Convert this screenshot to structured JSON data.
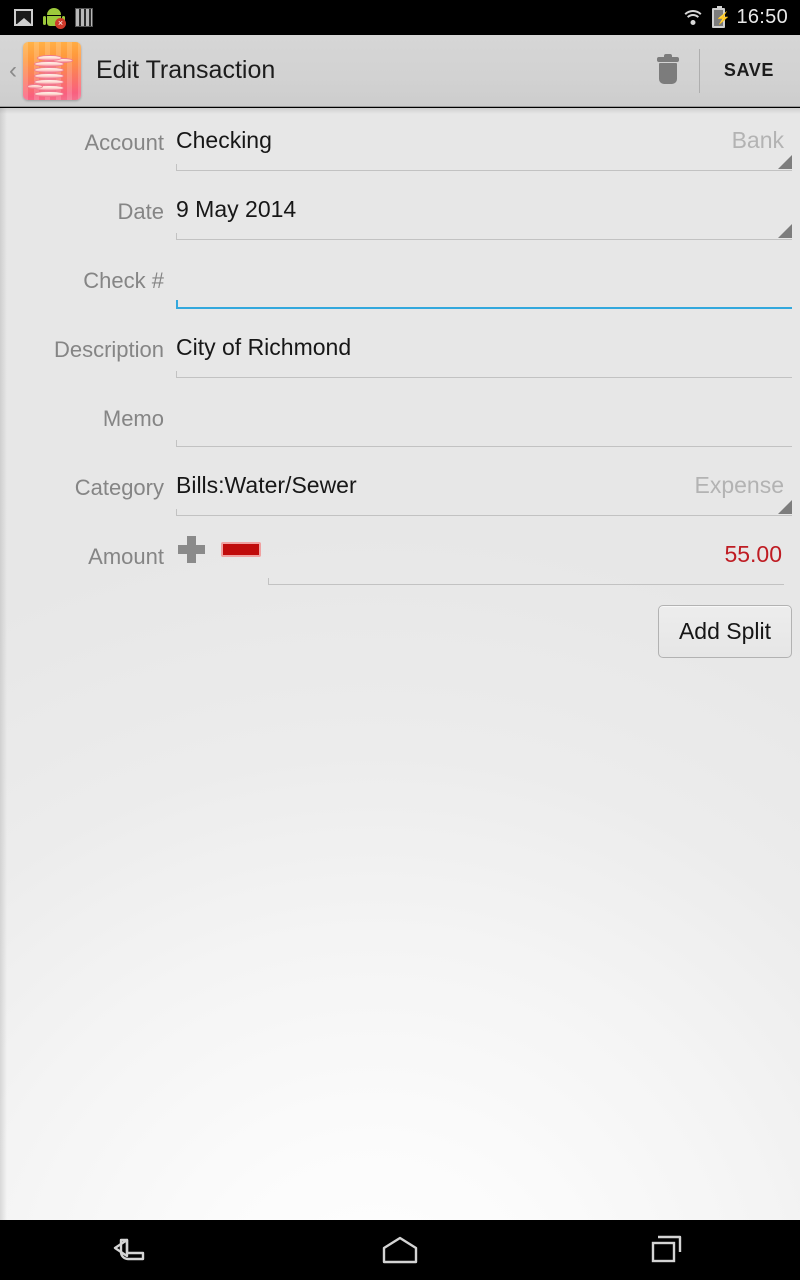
{
  "statusbar": {
    "time": "16:50",
    "icons": [
      {
        "name": "photo-icon"
      },
      {
        "name": "android-error-icon",
        "badge": "×"
      },
      {
        "name": "barcode-icon"
      },
      {
        "name": "wifi-icon"
      },
      {
        "name": "battery-charging-icon",
        "bolt": "⚡"
      }
    ]
  },
  "actionbar": {
    "back_glyph": "‹",
    "app_icon_name": "coin-stack-app-icon",
    "title": "Edit Transaction",
    "delete_icon_name": "trash-icon",
    "save_label": "SAVE"
  },
  "form": {
    "rows": [
      {
        "label": "Account",
        "value": "Checking",
        "hint": "Bank",
        "type": "spinner",
        "focused": false,
        "name": "account"
      },
      {
        "label": "Date",
        "value": "9 May 2014",
        "hint": "",
        "type": "spinner",
        "focused": false,
        "name": "date"
      },
      {
        "label": "Check #",
        "value": "",
        "hint": "",
        "type": "text",
        "focused": true,
        "name": "check-number"
      },
      {
        "label": "Description",
        "value": "City of Richmond",
        "hint": "",
        "type": "text",
        "focused": false,
        "name": "description"
      },
      {
        "label": "Memo",
        "value": "",
        "hint": "",
        "type": "text",
        "focused": false,
        "name": "memo"
      },
      {
        "label": "Category",
        "value": "Bills:Water/Sewer",
        "hint": "Expense",
        "type": "spinner",
        "focused": false,
        "name": "category"
      }
    ],
    "amount": {
      "label": "Amount",
      "plus_name": "amount-sign-plus",
      "minus_name": "amount-sign-minus",
      "value": "55.00",
      "selected_sign": "minus"
    },
    "add_split_label": "Add Split"
  },
  "navbar": {
    "back_name": "nav-back-icon",
    "home_name": "nav-home-icon",
    "recents_name": "nav-recents-icon"
  },
  "colors": {
    "accent_focus": "#33a8dd",
    "negative_amount": "#bf1c23",
    "minus_red": "#c00b0b",
    "label_gray": "#858585",
    "hint_gray": "#b3b3b3"
  }
}
